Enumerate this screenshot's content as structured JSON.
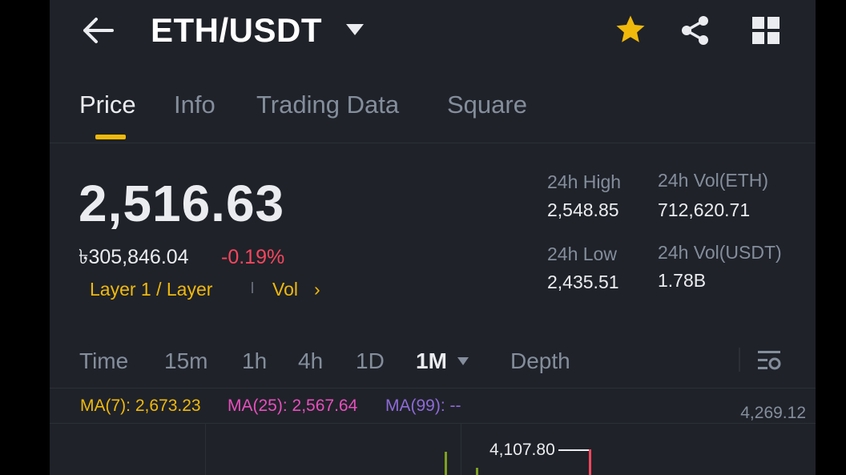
{
  "header": {
    "pair": "ETH/USDT",
    "back_icon": "arrow-left-icon",
    "favorite_icon": "star-icon",
    "favorite_color": "#f0b90b",
    "share_icon": "share-icon",
    "more_icon": "grid-icon"
  },
  "tabs": [
    {
      "label": "Price",
      "active": true
    },
    {
      "label": "Info",
      "active": false
    },
    {
      "label": "Trading Data",
      "active": false
    },
    {
      "label": "Square",
      "active": false
    }
  ],
  "ticker": {
    "last_price": "2,516.63",
    "fiat_price": "৳305,846.04",
    "change": "-0.19%",
    "change_color": "#f6465d",
    "tag_category": "Layer 1 / Layer",
    "tag_vol": "Vol",
    "tag_arrow": "›"
  },
  "stats": {
    "high_label": "24h High",
    "high_value": "2,548.85",
    "low_label": "24h Low",
    "low_value": "2,435.51",
    "vol_eth_label": "24h Vol(ETH)",
    "vol_eth_value": "712,620.71",
    "vol_usdt_label": "24h Vol(USDT)",
    "vol_usdt_value": "1.78B"
  },
  "intervals": {
    "items": [
      "Time",
      "15m",
      "1h",
      "4h",
      "1D",
      "1M",
      "Depth"
    ],
    "selected": "1M",
    "settings_icon": "chart-settings-icon"
  },
  "indicators": {
    "ma7": "MA(7): 2,673.23",
    "ma25": "MA(25): 2,567.64",
    "ma99": "MA(99): --",
    "ma7_color": "#f0b90b",
    "ma25_color": "#e84fbd",
    "ma99_color": "#8e6bd8"
  },
  "chart": {
    "axis_top_value": "4,269.12",
    "high_marker": "4,107.80"
  }
}
